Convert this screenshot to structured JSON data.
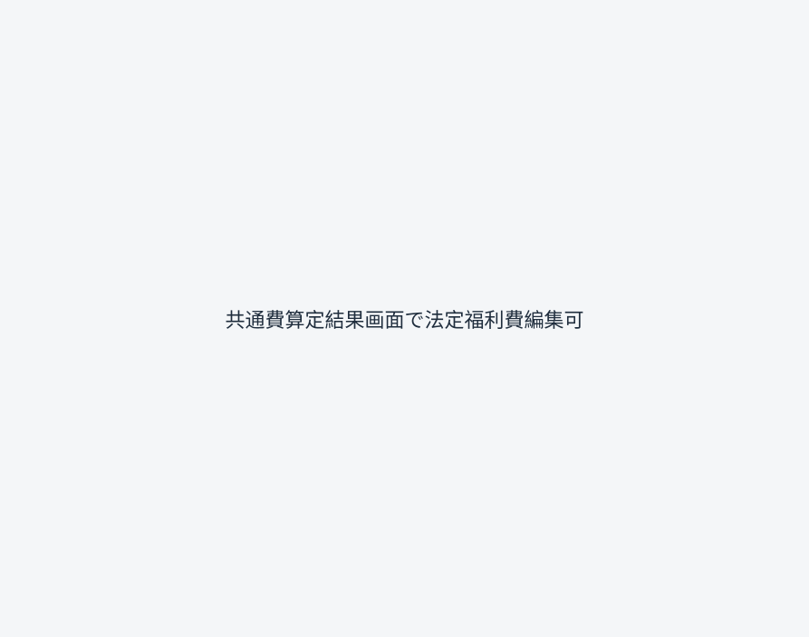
{
  "caption": "共通費算定結果画面で法定福利費編集可"
}
